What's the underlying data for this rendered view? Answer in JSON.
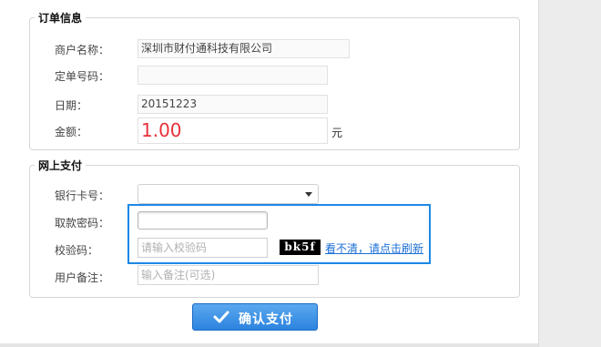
{
  "order_info": {
    "legend": "订单信息",
    "merchant_label": "商户名称：",
    "merchant_value": "深圳市财付通科技有限公司",
    "order_no_label": "定单号码：",
    "order_no_value": "",
    "date_label": "日期：",
    "date_value": "20151223",
    "amount_label": "金额：",
    "amount_value": "1.00",
    "amount_unit": "元"
  },
  "online_pay": {
    "legend": "网上支付",
    "card_label": "银行卡号：",
    "card_value": "",
    "password_label": "取款密码：",
    "password_value": "",
    "captcha_label": "校验码：",
    "captcha_placeholder": "请输入校验码",
    "captcha_image_text": "bk5f",
    "refresh_link": "看不清，请点击刷新",
    "remark_label": "用户备注：",
    "remark_placeholder": "输入备注(可选)"
  },
  "submit": {
    "label": "确认支付"
  },
  "colors": {
    "accent": "#1e88e5",
    "amount": "#e8303a",
    "button": "#2c83de"
  }
}
